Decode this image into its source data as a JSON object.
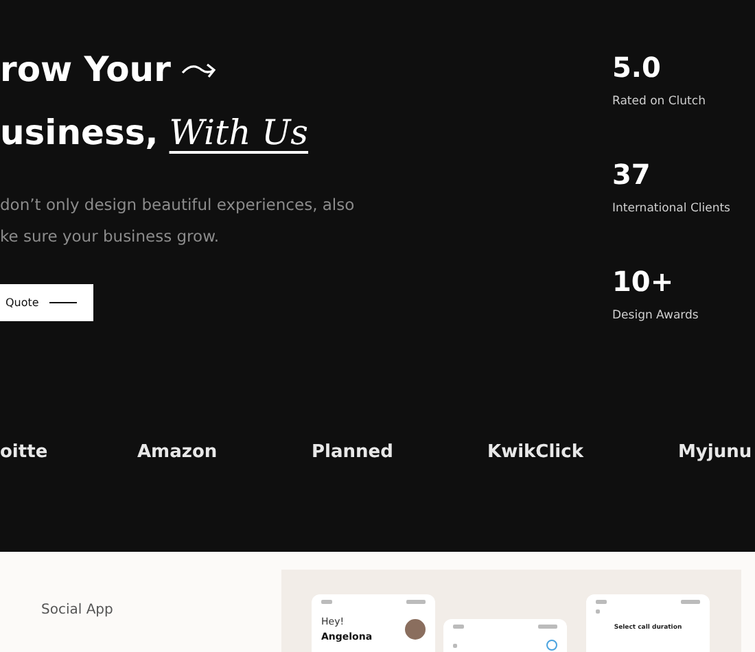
{
  "hero": {
    "heading": [
      {
        "text": "row Your",
        "arrow": true
      },
      {
        "text": "usiness,",
        "accent": "With Us",
        "arrow": false
      }
    ],
    "paragraph": [
      "don’t only design beautiful experiences, also",
      "ke sure your business grow."
    ],
    "button": "Quote"
  },
  "stats": [
    {
      "value": "5.0",
      "label": "Rated on Clutch"
    },
    {
      "value": "37",
      "label": "International Clients"
    },
    {
      "value": "10+",
      "label": "Design Awards"
    }
  ],
  "logos": [
    "oitte",
    "Amazon",
    "Planned",
    "KwikClick",
    "Myjunu"
  ],
  "project": {
    "title": "Social App",
    "screens": [
      {
        "kind": "greeting",
        "greeting": "Hey!",
        "name": "Angelona"
      },
      {
        "kind": "list"
      },
      {
        "kind": "duration",
        "heading": "Select call duration"
      }
    ]
  }
}
